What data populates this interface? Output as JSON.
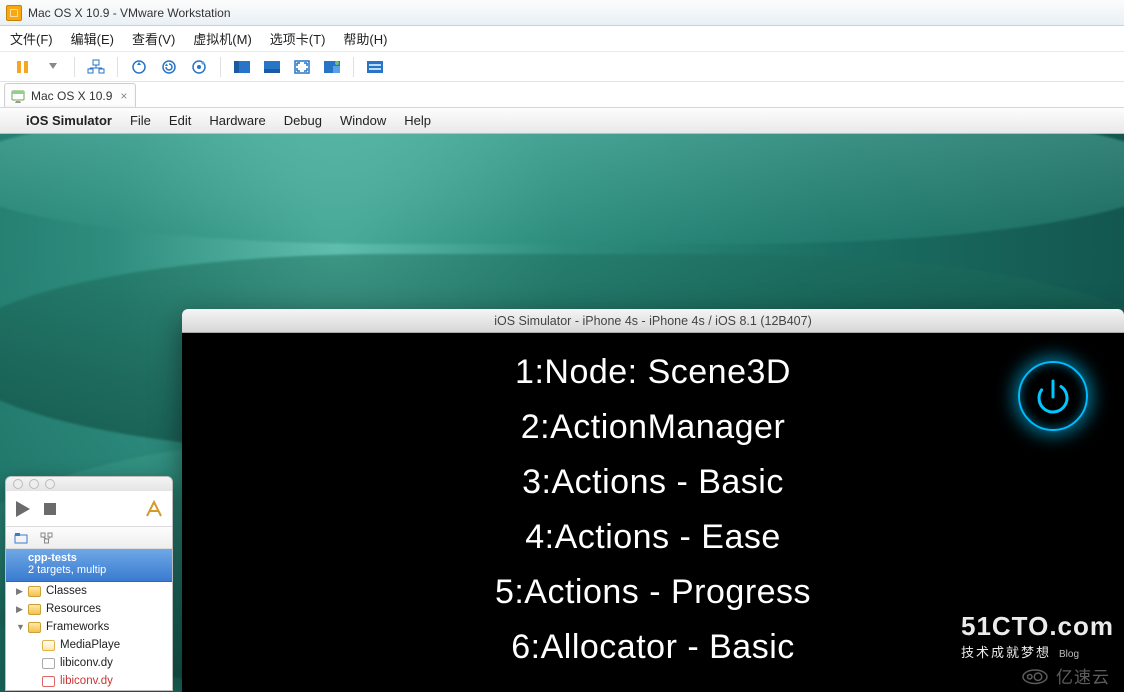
{
  "vmware": {
    "title": "Mac OS X 10.9 - VMware Workstation",
    "menus": {
      "file": "文件(F)",
      "edit": "编辑(E)",
      "view": "查看(V)",
      "vm": "虚拟机(M)",
      "tabs": "选项卡(T)",
      "help": "帮助(H)"
    },
    "tab": {
      "label": "Mac OS X 10.9"
    }
  },
  "mac_menubar": {
    "app": "iOS Simulator",
    "items": {
      "file": "File",
      "edit": "Edit",
      "hardware": "Hardware",
      "debug": "Debug",
      "window": "Window",
      "help": "Help"
    }
  },
  "simulator": {
    "title": "iOS Simulator - iPhone 4s - iPhone 4s / iOS 8.1 (12B407)",
    "rows": {
      "r1": "1:Node: Scene3D",
      "r2": "2:ActionManager",
      "r3": "3:Actions - Basic",
      "r4": "4:Actions - Ease",
      "r5": "5:Actions - Progress",
      "r6": "6:Allocator - Basic"
    }
  },
  "xcode": {
    "project": "cpp-tests",
    "sub": "2 targets, multip",
    "tree": {
      "classes": "Classes",
      "resources": "Resources",
      "frameworks": "Frameworks",
      "mediaplayer": "MediaPlaye",
      "libiconv1": "libiconv.dy",
      "libiconv2": "libiconv.dy"
    }
  },
  "watermarks": {
    "cto_l1": "51CTO.com",
    "cto_l2": "技术成就梦想",
    "cto_blog": "Blog",
    "ysy": "亿速云"
  }
}
